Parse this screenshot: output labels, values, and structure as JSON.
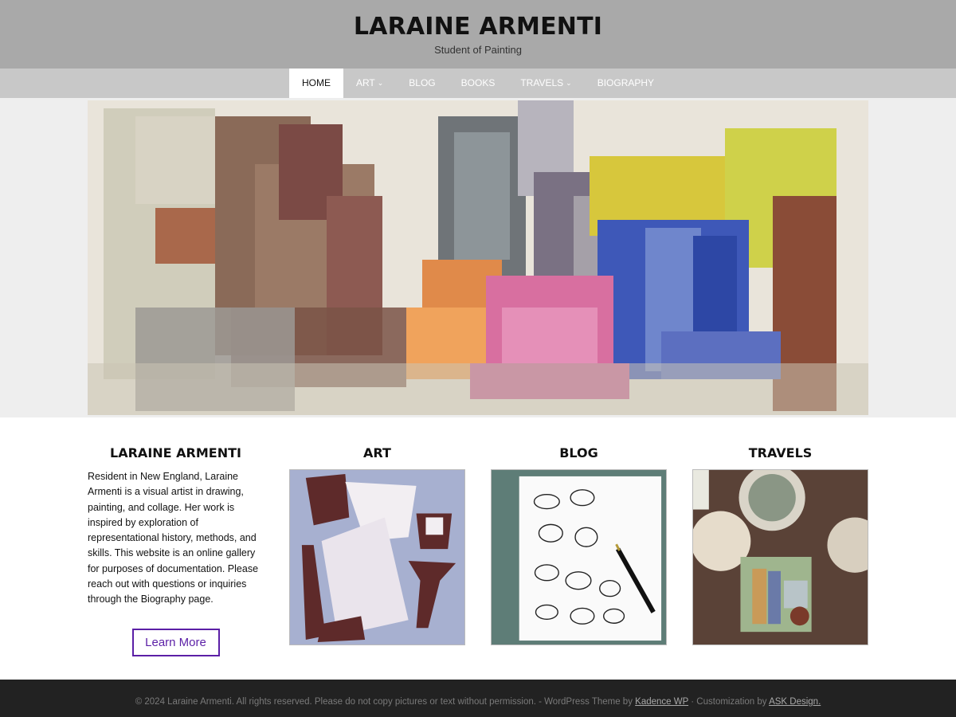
{
  "header": {
    "title": "LARAINE ARMENTI",
    "tagline": "Student of Painting"
  },
  "nav": {
    "items": [
      {
        "label": "HOME",
        "active": true
      },
      {
        "label": "ART",
        "dropdown": true
      },
      {
        "label": "BLOG"
      },
      {
        "label": "BOOKS"
      },
      {
        "label": "TRAVELS",
        "dropdown": true
      },
      {
        "label": "BIOGRAPHY"
      }
    ]
  },
  "hero": {
    "image": "still-life-painting"
  },
  "sections": {
    "about": {
      "title": "LARAINE ARMENTI",
      "text": "Resident in New England, Laraine Armenti is a visual artist in drawing, painting, and collage. Her work is inspired by exploration of representational history, methods, and skills. This website is an online gallery for purposes of documentation. Please reach out with questions or inquiries through the Biography page.",
      "button": "Learn More"
    },
    "art": {
      "title": "ART",
      "image": "collage-artwork"
    },
    "blog": {
      "title": "BLOG",
      "image": "turkey-sketchbook"
    },
    "travels": {
      "title": "TRAVELS",
      "image": "painting-palette-collage"
    }
  },
  "footer": {
    "text": "© 2024 Laraine Armenti. All rights reserved. Please do not copy pictures or text without permission. - WordPress Theme by ",
    "link1": "Kadence WP",
    "middle": " · Customization by ",
    "link2": "ASK Design."
  },
  "colors": {
    "header_bg": "#a9a9a9",
    "nav_bg": "#c8c8c8",
    "button_accent": "#5b1fa6",
    "footer_bg": "#222222"
  }
}
